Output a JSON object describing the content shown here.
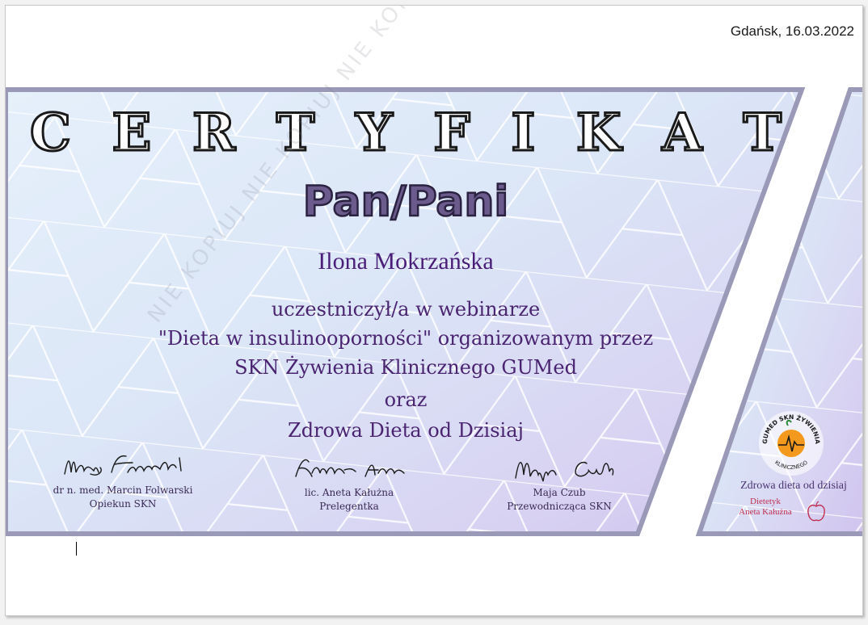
{
  "date": "Gdańsk, 16.03.2022",
  "title_letters": [
    "C",
    "E",
    "R",
    "T",
    "Y",
    "F",
    "I",
    "K",
    "A",
    "T"
  ],
  "honorific": "Pan/Pani",
  "recipient": "Ilona Mokrzańska",
  "body": {
    "line1": "uczestniczył/a w webinarze",
    "line2": "\"Dieta w insulinooporności\" organizowanym przez",
    "line3": "SKN Żywienia Klinicznego GUMed",
    "line4": "oraz",
    "line5": "Zdrowa Dieta od Dzisiaj"
  },
  "signatures": [
    {
      "scribble": "Marin Folwarski",
      "name": "dr n. med. Marcin Folwarski",
      "role": "Opiekun SKN"
    },
    {
      "scribble": "Kałużna Aneta",
      "name": "lic. Aneta Kałużna",
      "role": "Prelegentka"
    },
    {
      "scribble": "Maja Czub",
      "name": "Maja Czub",
      "role": "Przewodnicząca SKN"
    }
  ],
  "logo_skn": {
    "top": "SKN",
    "left": "GUMED",
    "right": "ŻYWIENIA",
    "bottom": "KLINICZNEGO"
  },
  "logo_zdd": {
    "title": "Zdrowa dieta od dzisiaj",
    "sub1": "Dietetyk",
    "sub2": "Aneta Kałużna"
  },
  "watermark": "NIE KOPIUJ NIE KOPIUJ NIE KOPIUJ NIE KOPIUJ",
  "colors": {
    "accent": "#4a2470",
    "panel_border": "#9a9ab8",
    "orange": "#f39a1e"
  }
}
